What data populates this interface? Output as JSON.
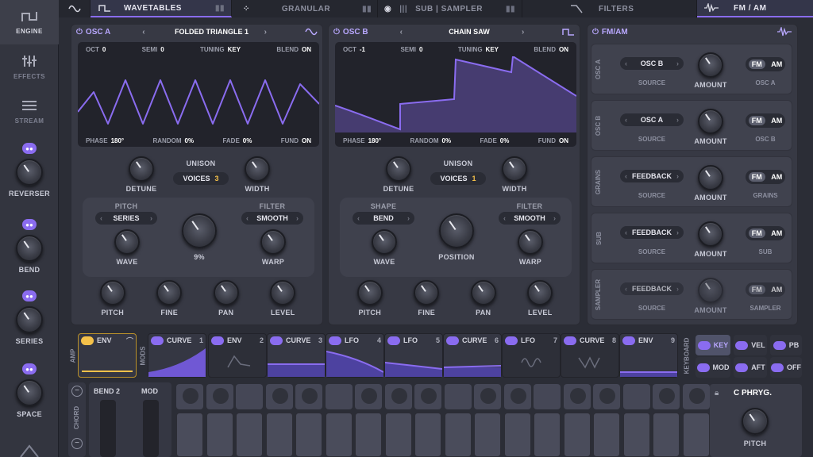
{
  "sidebar": {
    "engine": "ENGINE",
    "effects": "EFFECTS",
    "stream": "STREAM",
    "mods": [
      {
        "label": "REVERSER"
      },
      {
        "label": "BEND"
      },
      {
        "label": "SERIES"
      },
      {
        "label": "SPACE"
      }
    ]
  },
  "tabs": {
    "wavetables": "WAVETABLES",
    "granular": "GRANULAR",
    "sub_sampler": "SUB | SAMPLER",
    "filters": "FILTERS",
    "fm_am": "FM / AM"
  },
  "osc_a": {
    "title": "OSC A",
    "wave": "FOLDED TRIANGLE 1",
    "oct_l": "OCT",
    "oct": "0",
    "semi_l": "SEMI",
    "semi": "0",
    "tuning_l": "TUNING",
    "tuning": "KEY",
    "blend_l": "BLEND",
    "blend": "ON",
    "phase_l": "PHASE",
    "phase": "180°",
    "random_l": "RANDOM",
    "random": "0%",
    "fade_l": "FADE",
    "fade": "0%",
    "fund_l": "FUND",
    "fund": "ON",
    "detune": "DETUNE",
    "unison": "UNISON",
    "voices_l": "VOICES",
    "voices": "3",
    "width": "WIDTH",
    "pitch_l": "PITCH",
    "pitch_sel": "SERIES",
    "center_val": "9%",
    "filter_l": "FILTER",
    "filter_sel": "SMOOTH",
    "wave_k": "WAVE",
    "warp": "WARP",
    "k_pitch": "PITCH",
    "k_fine": "FINE",
    "k_pan": "PAN",
    "k_level": "LEVEL"
  },
  "osc_b": {
    "title": "OSC B",
    "wave": "CHAIN SAW",
    "oct_l": "OCT",
    "oct": "-1",
    "semi_l": "SEMI",
    "semi": "0",
    "tuning_l": "TUNING",
    "tuning": "KEY",
    "blend_l": "BLEND",
    "blend": "ON",
    "phase_l": "PHASE",
    "phase": "180°",
    "random_l": "RANDOM",
    "random": "0%",
    "fade_l": "FADE",
    "fade": "0%",
    "fund_l": "FUND",
    "fund": "ON",
    "detune": "DETUNE",
    "unison": "UNISON",
    "voices_l": "VOICES",
    "voices": "1",
    "width": "WIDTH",
    "shape_l": "SHAPE",
    "shape_sel": "BEND",
    "center_val": "POSITION",
    "filter_l": "FILTER",
    "filter_sel": "SMOOTH",
    "wave_k": "WAVE",
    "warp": "WARP",
    "k_pitch": "PITCH",
    "k_fine": "FINE",
    "k_pan": "PAN",
    "k_level": "LEVEL"
  },
  "fmam": {
    "title": "FM/AM",
    "rows": [
      {
        "side": "OSC A",
        "source": "OSC B",
        "source_l": "SOURCE",
        "amount_l": "AMOUNT",
        "fm": "FM",
        "am": "AM",
        "target": "OSC A"
      },
      {
        "side": "OSC B",
        "source": "OSC A",
        "source_l": "SOURCE",
        "amount_l": "AMOUNT",
        "fm": "FM",
        "am": "AM",
        "target": "OSC B"
      },
      {
        "side": "GRAINS",
        "source": "FEEDBACK",
        "source_l": "SOURCE",
        "amount_l": "AMOUNT",
        "fm": "FM",
        "am": "AM",
        "target": "GRAINS"
      },
      {
        "side": "SUB",
        "source": "FEEDBACK",
        "source_l": "SOURCE",
        "amount_l": "AMOUNT",
        "fm": "FM",
        "am": "AM",
        "target": "SUB"
      },
      {
        "side": "SAMPLER",
        "source": "FEEDBACK",
        "source_l": "SOURCE",
        "amount_l": "AMOUNT",
        "fm": "FM",
        "am": "AM",
        "target": "SAMPLER"
      }
    ]
  },
  "mods": {
    "amp_l": "AMP",
    "mods_l": "MODS",
    "amp_env": "ENV",
    "slots": [
      {
        "name": "CURVE",
        "n": "1"
      },
      {
        "name": "ENV",
        "n": "2"
      },
      {
        "name": "CURVE",
        "n": "3"
      },
      {
        "name": "LFO",
        "n": "4"
      },
      {
        "name": "LFO",
        "n": "5"
      },
      {
        "name": "CURVE",
        "n": "6"
      },
      {
        "name": "LFO",
        "n": "7"
      },
      {
        "name": "CURVE",
        "n": "8"
      },
      {
        "name": "ENV",
        "n": "9"
      }
    ]
  },
  "keyboard": {
    "label": "KEYBOARD",
    "key": "KEY",
    "vel": "VEL",
    "pb": "PB",
    "mod": "MOD",
    "aft": "AFT",
    "off": "OFF"
  },
  "bottom": {
    "chord": "CHORD",
    "bend": "BEND",
    "bend_n": "2",
    "mod": "MOD",
    "scale": "C PHRYG.",
    "pitch": "PITCH"
  }
}
